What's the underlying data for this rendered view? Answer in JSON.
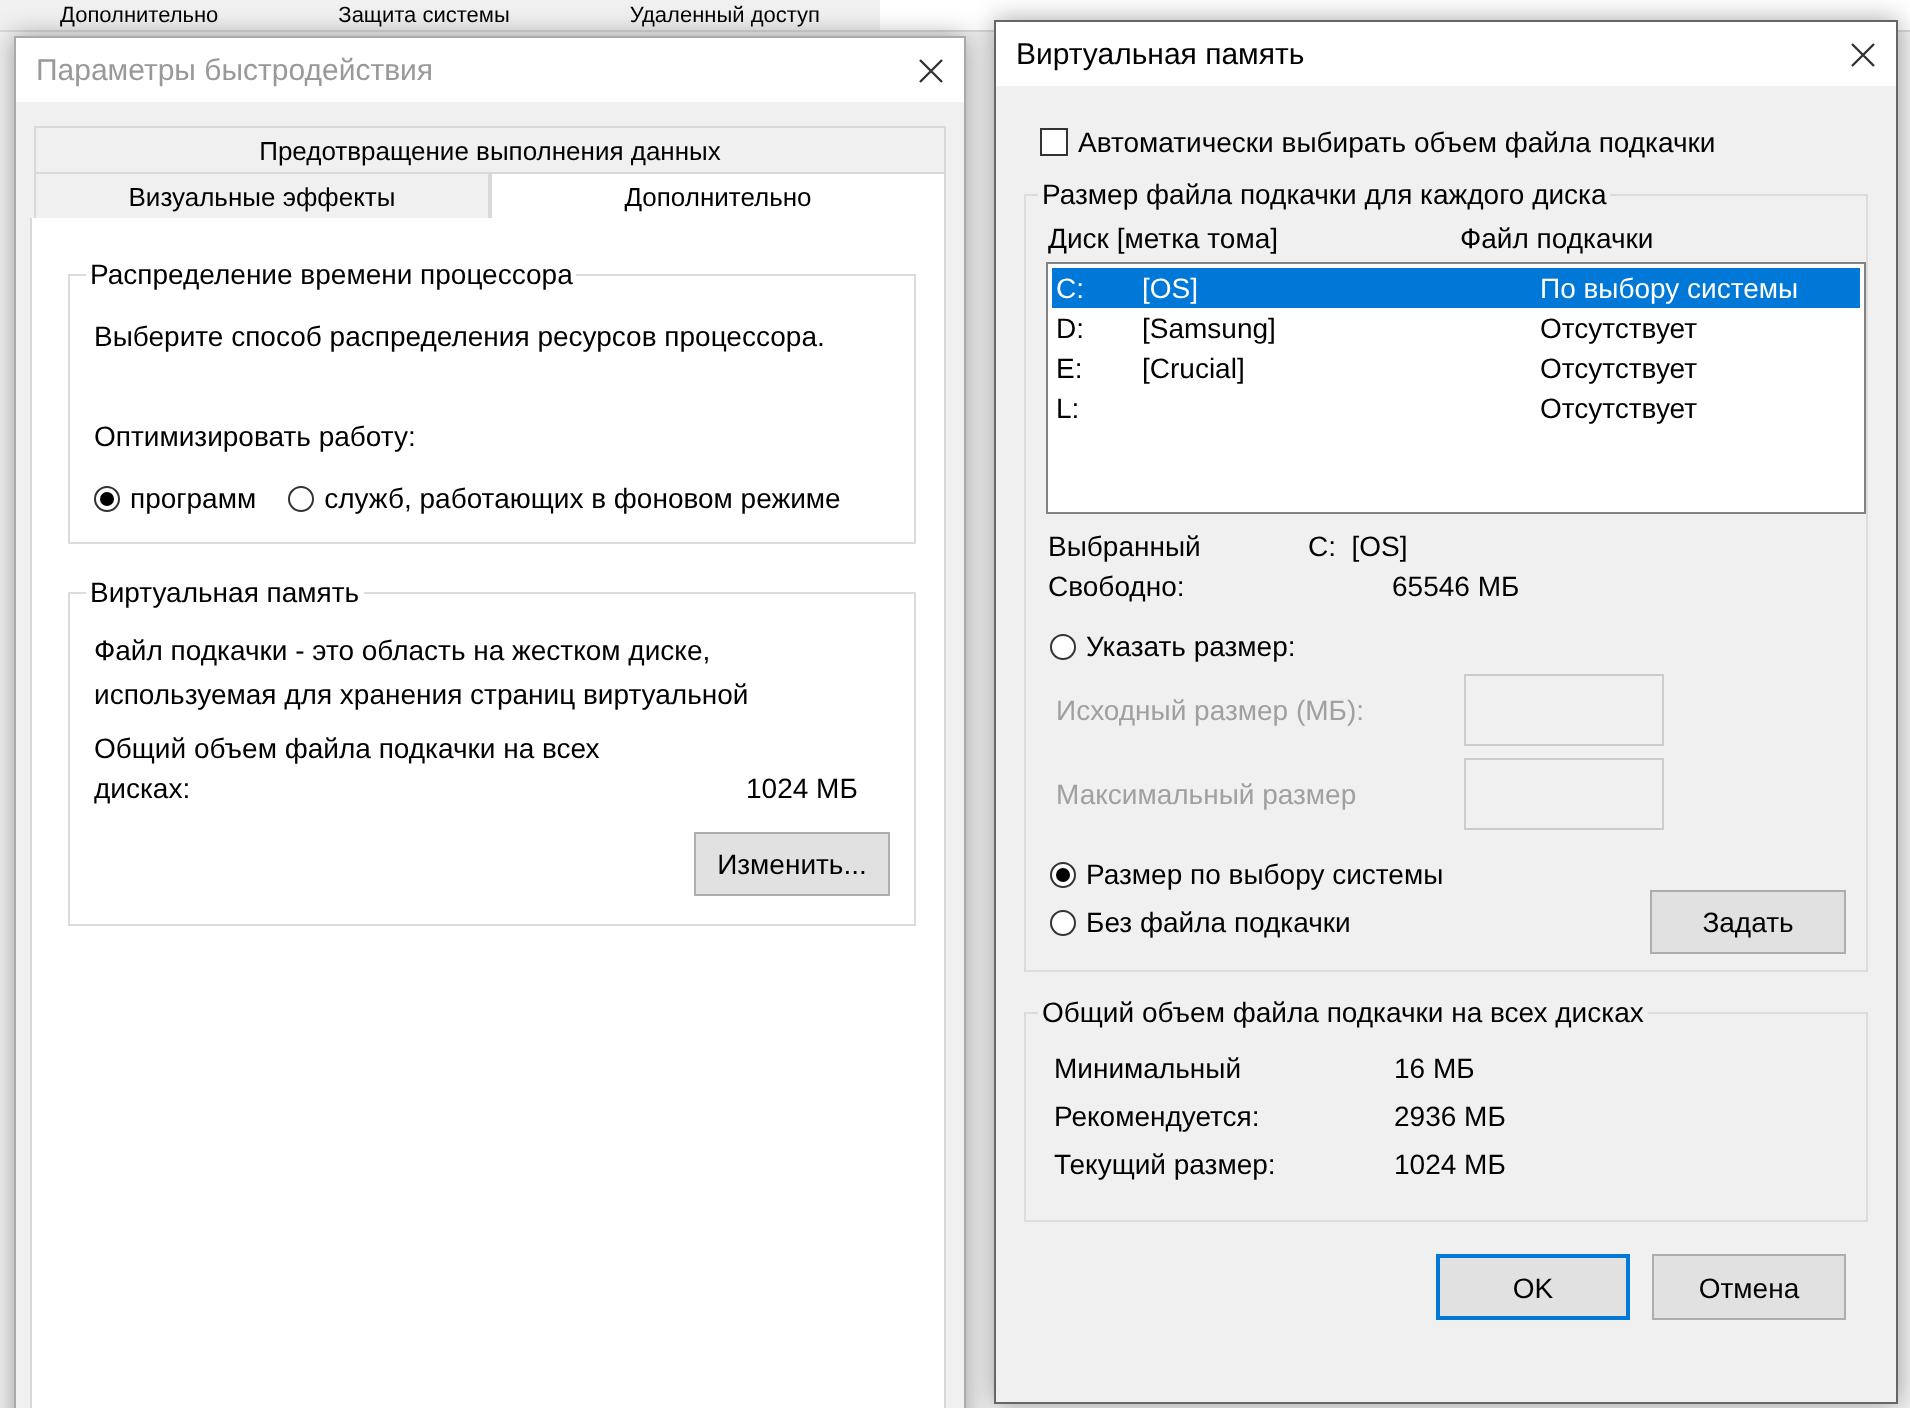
{
  "background_window": {
    "tabs": [
      {
        "label": "Дополнительно",
        "selected": false
      },
      {
        "label": "Защита системы",
        "selected": false
      },
      {
        "label": "Удаленный доступ",
        "selected": false
      }
    ]
  },
  "performance_window": {
    "title": "Параметры быстродействия",
    "tabs_top": [
      {
        "label": "Предотвращение выполнения данных",
        "selected": false
      }
    ],
    "tabs": [
      {
        "label": "Визуальные эффекты",
        "selected": false
      },
      {
        "label": "Дополнительно",
        "selected": true
      }
    ],
    "processor_group": {
      "title": "Распределение времени процессора",
      "description": "Выберите способ распределения ресурсов процессора.",
      "prompt": "Оптимизировать работу:",
      "options": [
        {
          "label": "программ",
          "selected": true
        },
        {
          "label": "служб, работающих в фоновом режиме",
          "selected": false
        }
      ]
    },
    "vm_group": {
      "title": "Виртуальная память",
      "description": "Файл подкачки - это область на жестком диске, используемая для хранения страниц виртуальной",
      "total_label": "Общий объем файла подкачки на всех дисках:",
      "total_value": "1024 МБ",
      "button": "Изменить..."
    }
  },
  "virtual_memory_window": {
    "title": "Виртуальная память",
    "auto_checkbox": {
      "label": "Автоматически выбирать объем файла подкачки",
      "checked": false
    },
    "drives_group": {
      "title": "Размер файла подкачки для каждого диска",
      "columns": [
        "Диск [метка тома]",
        "Файл подкачки"
      ],
      "drives": [
        {
          "letter": "C:",
          "label": "[OS]",
          "paging": "По выбору системы",
          "selected": true
        },
        {
          "letter": "D:",
          "label": "[Samsung]",
          "paging": "Отсутствует",
          "selected": false
        },
        {
          "letter": "E:",
          "label": "[Crucial]",
          "paging": "Отсутствует",
          "selected": false
        },
        {
          "letter": "L:",
          "paging": "Отсутствует",
          "selected": false
        }
      ],
      "selected_label": "Выбранный",
      "selected_value": "C:  [OS]",
      "free_label": "Свободно:",
      "free_value": "65546 МБ",
      "options": [
        {
          "kind": "custom",
          "label": "Указать размер:",
          "selected": false
        },
        {
          "kind": "system",
          "label": "Размер по выбору системы",
          "selected": true
        },
        {
          "kind": "none",
          "label": "Без файла подкачки",
          "selected": false
        }
      ],
      "size_fields": [
        {
          "label": "Исходный размер (МБ):",
          "disabled": true
        },
        {
          "label": "Максимальный размер",
          "disabled": true
        }
      ],
      "set_button": "Задать"
    },
    "totals_group": {
      "title": "Общий объем файла подкачки на всех дисках",
      "rows": [
        {
          "label": "Минимальный",
          "value": "16 МБ"
        },
        {
          "label": "Рекомендуется:",
          "value": "2936 МБ"
        },
        {
          "label": "Текущий размер:",
          "value": "1024 МБ"
        }
      ]
    },
    "buttons": [
      {
        "label": "OK",
        "default": true
      },
      {
        "label": "Отмена",
        "default": false
      }
    ]
  }
}
